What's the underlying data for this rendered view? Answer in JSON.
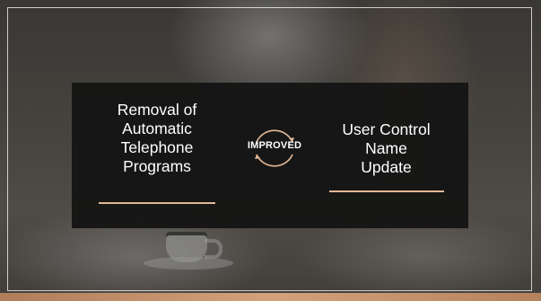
{
  "slide": {
    "left_text": "Removal of\nAutomatic\nTelephone\nPrograms",
    "center_label": "IMPROVED",
    "right_text": "User Control\nName\nUpdate"
  },
  "colors": {
    "accent": "#e2b895",
    "bottom_bar": "#c8946b",
    "panel": "#121212"
  },
  "icons": {
    "center": "circular-arrows-icon"
  }
}
